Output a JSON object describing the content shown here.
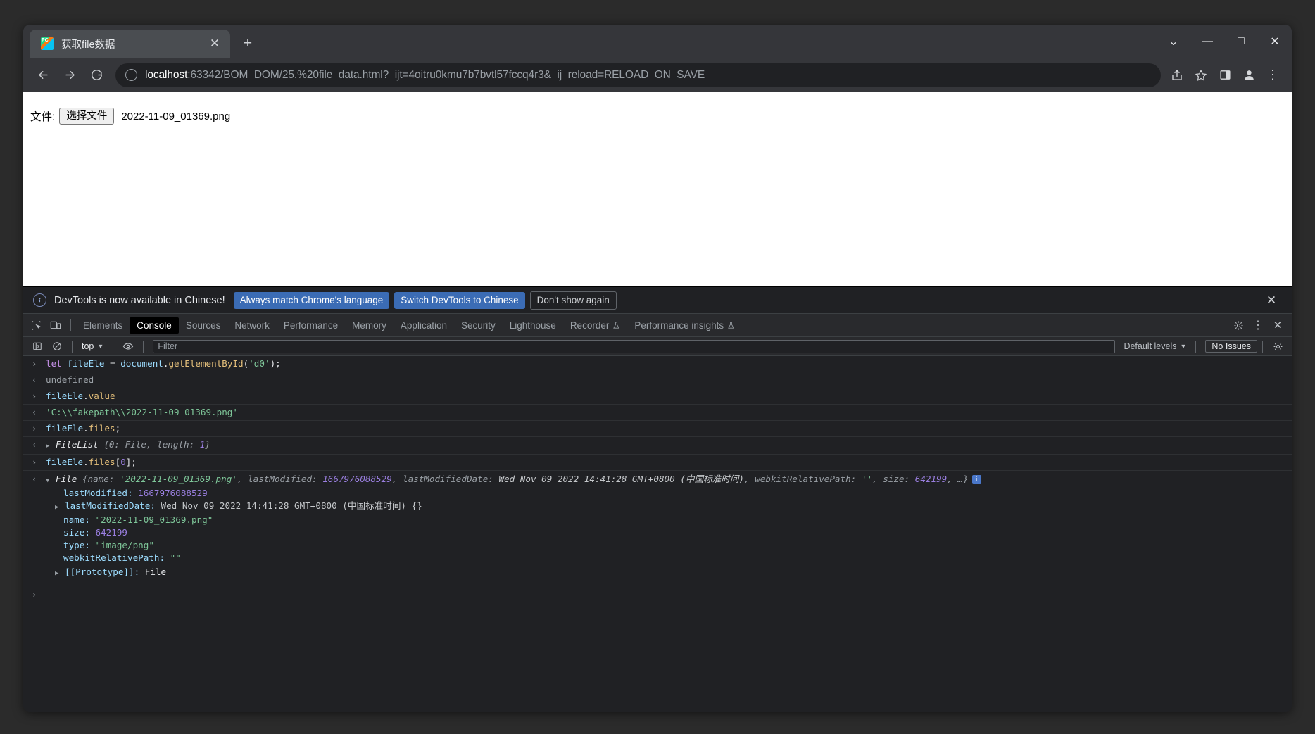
{
  "window": {
    "controls": {
      "chevron": "⌄",
      "minimize": "—",
      "maximize": "□",
      "close": "✕"
    }
  },
  "tab": {
    "title": "获取file数据",
    "favicon": "pycharm-icon",
    "close_label": "✕",
    "newtab_label": "+"
  },
  "toolbar": {
    "back": "←",
    "forward": "→",
    "reload": "⟳",
    "share": "share-icon",
    "bookmark": "☆",
    "sidepanel": "side-panel-icon",
    "profile": "profile-icon",
    "menu": "⋮",
    "url_host": "localhost",
    "url_rest": ":63342/BOM_DOM/25.%20file_data.html?_ijt=4oitru0kmu7b7bvtl57fccq4r3&_ij_reload=RELOAD_ON_SAVE",
    "info_glyph": "ⓘ"
  },
  "page": {
    "file_label": "文件:",
    "file_button": "选择文件",
    "file_name": "2022-11-09_01369.png"
  },
  "devtools": {
    "banner": {
      "message": "DevTools is now available in Chinese!",
      "btn_match": "Always match Chrome's language",
      "btn_switch": "Switch DevTools to Chinese",
      "btn_dismiss": "Don't show again",
      "close": "✕"
    },
    "tabs": [
      {
        "label": "Elements",
        "active": false,
        "flask": false
      },
      {
        "label": "Console",
        "active": true,
        "flask": false
      },
      {
        "label": "Sources",
        "active": false,
        "flask": false
      },
      {
        "label": "Network",
        "active": false,
        "flask": false
      },
      {
        "label": "Performance",
        "active": false,
        "flask": false
      },
      {
        "label": "Memory",
        "active": false,
        "flask": false
      },
      {
        "label": "Application",
        "active": false,
        "flask": false
      },
      {
        "label": "Security",
        "active": false,
        "flask": false
      },
      {
        "label": "Lighthouse",
        "active": false,
        "flask": false
      },
      {
        "label": "Recorder",
        "active": false,
        "flask": true
      },
      {
        "label": "Performance insights",
        "active": false,
        "flask": true
      }
    ],
    "tab_right": {
      "settings": "gear-icon",
      "more": "⋮",
      "close": "✕"
    },
    "console_toolbar": {
      "sidebar_toggle": "sidebar-icon",
      "clear": "🚫",
      "context": "top",
      "context_caret": "▼",
      "eye": "eye-icon",
      "filter_placeholder": "Filter",
      "levels": "Default levels",
      "levels_caret": "▼",
      "issues": "No Issues",
      "settings": "gear-icon"
    },
    "console": {
      "entries": [
        {
          "type": "input",
          "gutter": "›",
          "text": "let fileEle = document.getElementById('d0');"
        },
        {
          "type": "output",
          "gutter": "‹",
          "text": "undefined"
        },
        {
          "type": "input",
          "gutter": "›",
          "text": "fileEle.value"
        },
        {
          "type": "output",
          "gutter": "‹",
          "text": "'C:\\\\fakepath\\\\2022-11-09_01369.png'"
        },
        {
          "type": "input",
          "gutter": "›",
          "text": "fileEle.files;"
        },
        {
          "type": "output",
          "gutter": "‹",
          "text": "FileList {0: File, length: 1}"
        },
        {
          "type": "input",
          "gutter": "›",
          "text": "fileEle.files[0];"
        },
        {
          "type": "output",
          "gutter": "‹",
          "text": "File {name: '2022-11-09_01369.png', lastModified: 1667976088529, lastModifiedDate: Wed Nov 09 2022 14:41:28 GMT+0800 (中国标准时间), webkitRelativePath: '', size: 642199, …}"
        }
      ],
      "file_object": {
        "header_class": "File",
        "summary_name_key": "name:",
        "summary_name_val": "'2022-11-09_01369.png'",
        "summary_lm_key": "lastModified:",
        "summary_lm_val": "1667976088529",
        "summary_lmd_key": "lastModifiedDate:",
        "summary_lmd_val": "Wed Nov 09 2022 14:41:28 GMT+0800 (中国标准时间)",
        "summary_wrp_key": "webkitRelativePath:",
        "summary_wrp_val": "''",
        "summary_size_key": "size:",
        "summary_size_val": "642199",
        "summary_ellipsis": "…}",
        "properties": [
          {
            "key": "lastModified:",
            "value": "1667976088529",
            "kind": "number",
            "expandable": false
          },
          {
            "key": "lastModifiedDate:",
            "value": "Wed Nov 09 2022 14:41:28 GMT+0800 (中国标准时间) {}",
            "kind": "object",
            "expandable": true
          },
          {
            "key": "name:",
            "value": "\"2022-11-09_01369.png\"",
            "kind": "string",
            "expandable": false
          },
          {
            "key": "size:",
            "value": "642199",
            "kind": "number",
            "expandable": false
          },
          {
            "key": "type:",
            "value": "\"image/png\"",
            "kind": "string",
            "expandable": false
          },
          {
            "key": "webkitRelativePath:",
            "value": "\"\"",
            "kind": "string",
            "expandable": false
          },
          {
            "key": "[[Prototype]]:",
            "value": "File",
            "kind": "proto",
            "expandable": true
          }
        ]
      },
      "final_prompt": "›"
    }
  }
}
